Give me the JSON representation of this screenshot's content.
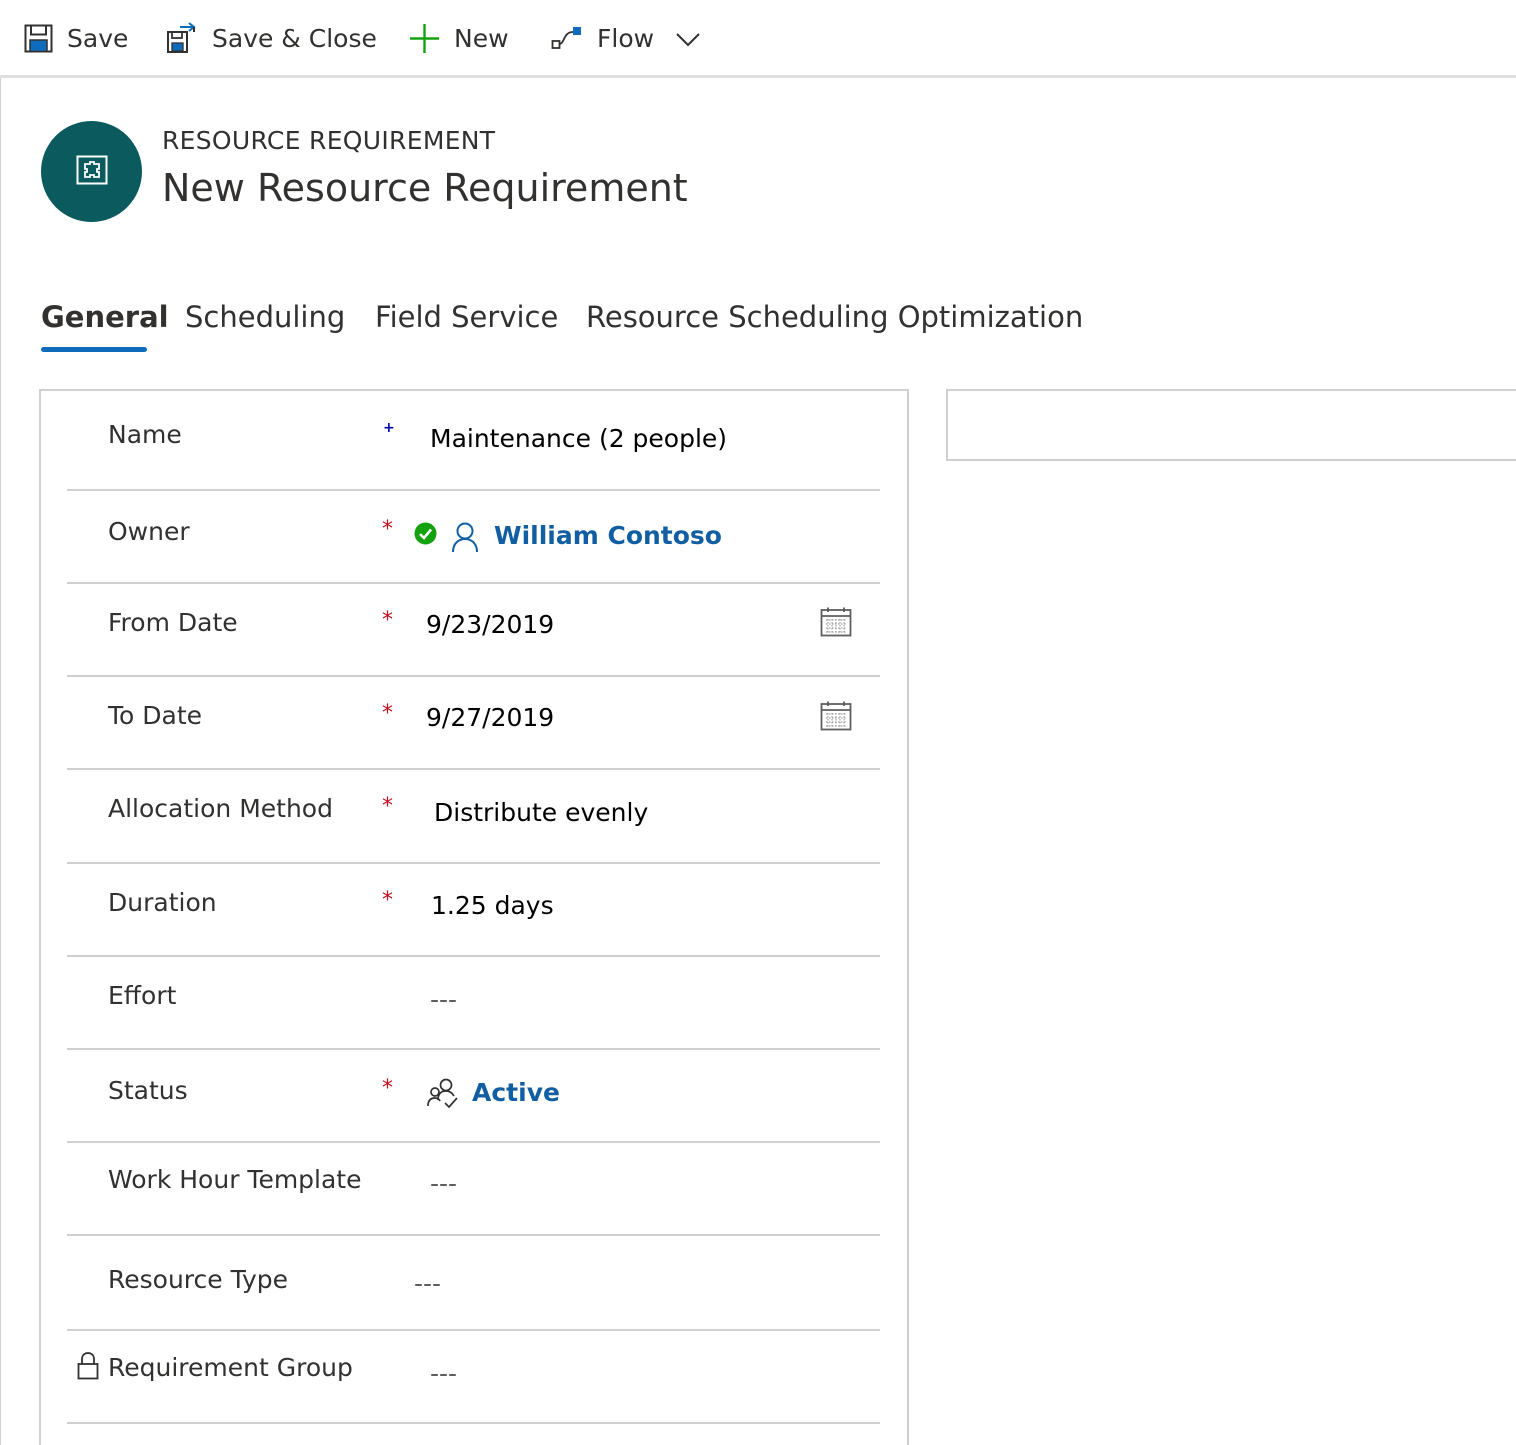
{
  "toolbar": {
    "save_label": "Save",
    "save_close_label": "Save & Close",
    "new_label": "New",
    "flow_label": "Flow"
  },
  "header": {
    "entity_type": "RESOURCE REQUIREMENT",
    "title": "New Resource Requirement",
    "avatar_color": "#0b5a5e"
  },
  "tabs": [
    {
      "label": "General",
      "active": true
    },
    {
      "label": "Scheduling"
    },
    {
      "label": "Field Service"
    },
    {
      "label": "Resource Scheduling Optimization"
    }
  ],
  "form": {
    "fields": [
      {
        "label": "Name",
        "marker": "+",
        "value": "Maintenance (2 people)"
      },
      {
        "label": "Owner",
        "marker": "*",
        "value": "William Contoso",
        "status_color": "#13a10e"
      },
      {
        "label": "From Date",
        "marker": "*",
        "value": "9/23/2019"
      },
      {
        "label": "To Date",
        "marker": "*",
        "value": "9/27/2019"
      },
      {
        "label": "Allocation Method",
        "marker": "*",
        "value": "Distribute evenly"
      },
      {
        "label": "Duration",
        "marker": "*",
        "value": "1.25 days"
      },
      {
        "label": "Effort",
        "marker": "",
        "value": "---"
      },
      {
        "label": "Status",
        "marker": "*",
        "value": "Active"
      },
      {
        "label": "Work Hour Template",
        "marker": "",
        "value": "---"
      },
      {
        "label": "Resource Type",
        "marker": "",
        "value": "---"
      },
      {
        "label": "Requirement Group",
        "marker": "",
        "value": "---",
        "locked": true
      }
    ]
  },
  "colors": {
    "accent": "#0f6cbd",
    "link": "#115ea3",
    "required": "#c50f1f",
    "border": "#d2d0ce"
  }
}
